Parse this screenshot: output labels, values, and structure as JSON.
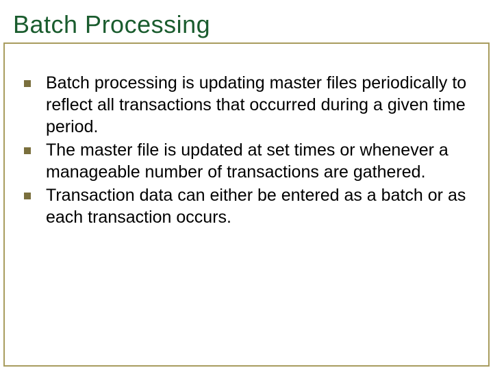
{
  "title": "Batch Processing",
  "bullets": [
    "Batch processing is updating master files periodically to reflect all transactions that occurred during a given time period.",
    "The master file is updated at set times or whenever a manageable number of transactions are gathered.",
    "Transaction data can either be entered as a batch or as each transaction occurs."
  ]
}
